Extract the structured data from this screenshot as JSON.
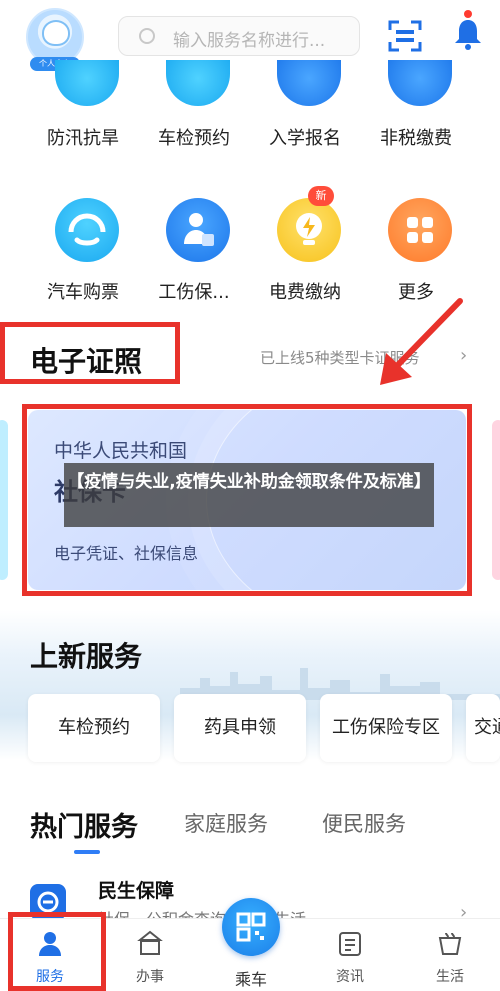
{
  "header": {
    "avatar_label": "个人中心",
    "search_placeholder": "输入服务名称进行..."
  },
  "services_row1": [
    {
      "label": "防汛抗旱",
      "icon": "flood-icon"
    },
    {
      "label": "车检预约",
      "icon": "car-inspection-icon"
    },
    {
      "label": "入学报名",
      "icon": "school-icon"
    },
    {
      "label": "非税缴费",
      "icon": "payment-icon"
    }
  ],
  "services_row2": [
    {
      "label": "汽车购票",
      "icon": "bus-ticket-icon"
    },
    {
      "label": "工伤保...",
      "icon": "injury-insurance-icon"
    },
    {
      "label": "电费缴纳",
      "icon": "electricity-icon"
    },
    {
      "label": "更多",
      "icon": "more-grid-icon"
    }
  ],
  "new_badge": "新",
  "e_license": {
    "title": "电子证照",
    "more_text": "已上线5种类型卡证服务",
    "card_country": "中华人民共和国",
    "card_type": "社保卡",
    "card_desc": "电子凭证、社保信息"
  },
  "overlay_text": "【疫情与失业,疫情失业补助金领取条件及标准】",
  "new_services": {
    "title": "上新服务",
    "items": [
      "车检预约",
      "药具申领",
      "工伤保险专区",
      "交通"
    ]
  },
  "hot_services": {
    "tabs": [
      "热门服务",
      "家庭服务",
      "便民服务"
    ],
    "item_title": "民生保障",
    "item_sub": "社保　公积金查询　居家生活"
  },
  "bottom_nav": {
    "items": [
      "服务",
      "办事",
      "乘车",
      "资讯",
      "生活"
    ]
  },
  "colors": {
    "accent": "#1f6fe5",
    "highlight_box": "#e8322b"
  }
}
